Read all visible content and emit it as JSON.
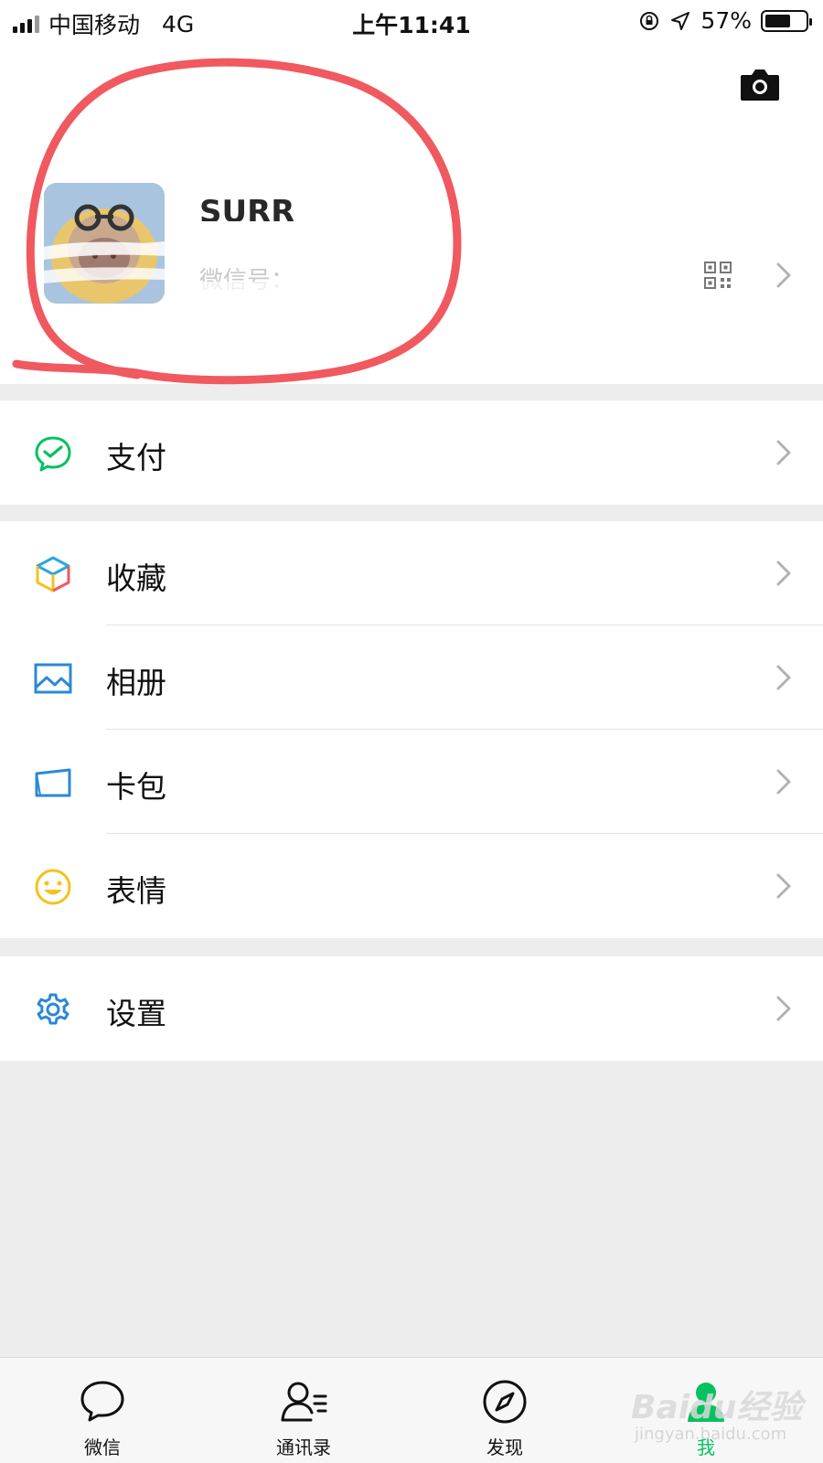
{
  "status_bar": {
    "carrier": "中国移动",
    "network": "4G",
    "time": "上午11:41",
    "battery_percent": "57%"
  },
  "profile": {
    "nickname": "SURR",
    "wechat_id_prefix": "微信号：",
    "icons": [
      "camera-icon",
      "qr-code-icon",
      "chevron-right-icon"
    ]
  },
  "menu": {
    "group1": [
      {
        "label": "支付",
        "icon": "wechat-pay-icon",
        "color": "#07c160"
      }
    ],
    "group2": [
      {
        "label": "收藏",
        "icon": "favorites-cube-icon",
        "color": "#2aa7e0"
      },
      {
        "label": "相册",
        "icon": "album-icon",
        "color": "#2b88d8"
      },
      {
        "label": "卡包",
        "icon": "card-wallet-icon",
        "color": "#2b88d8"
      },
      {
        "label": "表情",
        "icon": "sticker-smile-icon",
        "color": "#f4c21b"
      }
    ],
    "group3": [
      {
        "label": "设置",
        "icon": "settings-gear-icon",
        "color": "#2b88d8"
      }
    ]
  },
  "tabbar": [
    {
      "label": "微信",
      "icon": "chat-bubble-icon",
      "active": false
    },
    {
      "label": "通讯录",
      "icon": "contacts-icon",
      "active": false
    },
    {
      "label": "发现",
      "icon": "discover-compass-icon",
      "active": false
    },
    {
      "label": "我",
      "icon": "me-person-icon",
      "active": true
    }
  ],
  "colors": {
    "accent": "#07c160",
    "annotation_red": "#f0595f",
    "background": "#ededed"
  },
  "watermark": {
    "brand": "Baidu经验",
    "url": "jingyan.baidu.com"
  }
}
